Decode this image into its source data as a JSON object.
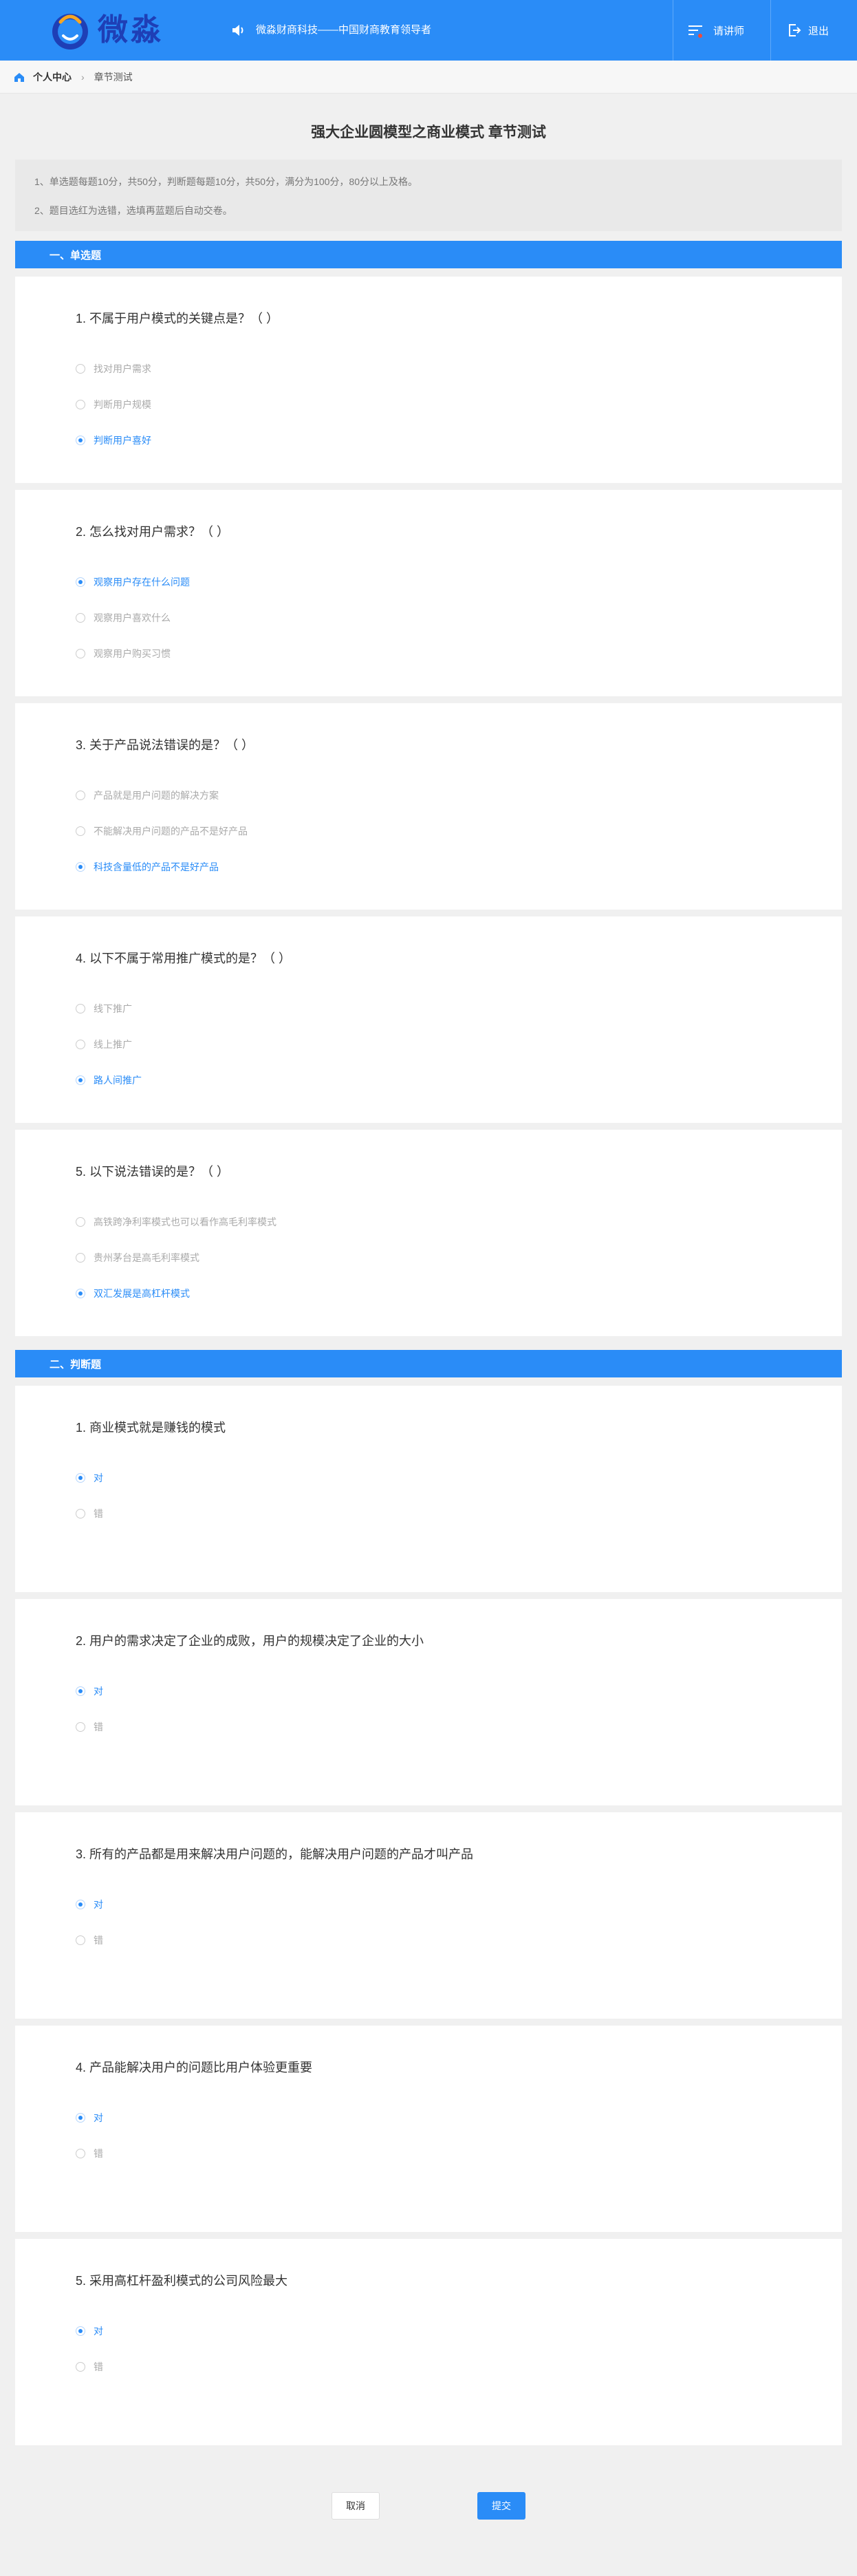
{
  "header": {
    "brand": "微淼",
    "slogan": "微淼财商科技——中国财商教育领导者",
    "lecturer_label": "请讲师",
    "logout_label": "退出",
    "accent_color": "#2a8cf7"
  },
  "breadcrumb": {
    "home": "个人中心",
    "current": "章节测试"
  },
  "page": {
    "title": "强大企业圆模型之商业模式 章节测试",
    "notices": [
      "1、单选题每题10分，共50分，判断题每题10分，共50分，满分为100分，80分以上及格。",
      "2、题目选红为选错，选填再蓝题后自动交卷。"
    ]
  },
  "sections": [
    {
      "label": "一、单选题",
      "questions": [
        {
          "title": "1. 不属于用户模式的关键点是？（ ）",
          "options": [
            "找对用户需求",
            "判断用户规模",
            "判断用户喜好"
          ],
          "selected": 2
        },
        {
          "title": "2. 怎么找对用户需求？（ ）",
          "options": [
            "观察用户存在什么问题",
            "观察用户喜欢什么",
            "观察用户购买习惯"
          ],
          "selected": 0
        },
        {
          "title": "3. 关于产品说法错误的是？（ ）",
          "options": [
            "产品就是用户问题的解决方案",
            "不能解决用户问题的产品不是好产品",
            "科技含量低的产品不是好产品"
          ],
          "selected": 2
        },
        {
          "title": "4. 以下不属于常用推广模式的是？（ ）",
          "options": [
            "线下推广",
            "线上推广",
            "路人间推广"
          ],
          "selected": 2
        },
        {
          "title": "5. 以下说法错误的是？（ ）",
          "options": [
            "高铁跨净利率模式也可以看作高毛利率模式",
            "贵州茅台是高毛利率模式",
            "双汇发展是高杠杆模式"
          ],
          "selected": 2
        }
      ]
    },
    {
      "label": "二、判断题",
      "questions": [
        {
          "title": "1. 商业模式就是赚钱的模式",
          "options": [
            "对",
            "错"
          ],
          "selected": 0
        },
        {
          "title": "2. 用户的需求决定了企业的成败，用户的规模决定了企业的大小",
          "options": [
            "对",
            "错"
          ],
          "selected": 0
        },
        {
          "title": "3. 所有的产品都是用来解决用户问题的，能解决用户问题的产品才叫产品",
          "options": [
            "对",
            "错"
          ],
          "selected": 0
        },
        {
          "title": "4. 产品能解决用户的问题比用户体验更重要",
          "options": [
            "对",
            "错"
          ],
          "selected": 0
        },
        {
          "title": "5. 采用高杠杆盈利模式的公司风险最大",
          "options": [
            "对",
            "错"
          ],
          "selected": 0
        }
      ]
    }
  ],
  "footer": {
    "cancel_label": "取消",
    "submit_label": "提交"
  }
}
